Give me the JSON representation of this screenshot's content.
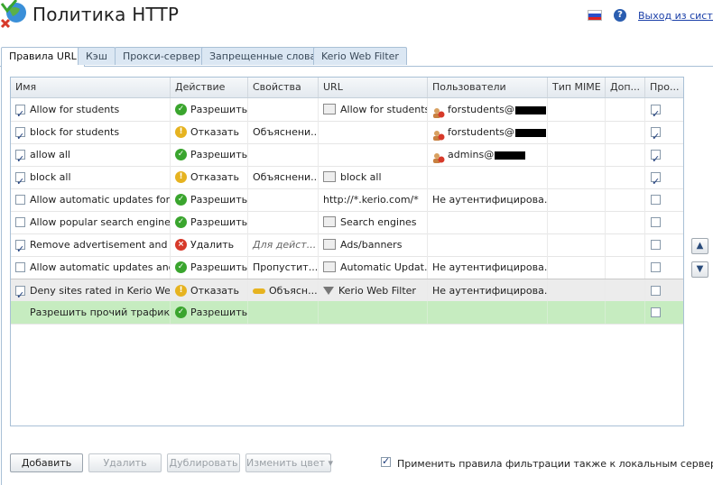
{
  "header": {
    "title": "Политика HTTP",
    "logout": "Выход из систем"
  },
  "tabs": [
    "Правила URL",
    "Кэш",
    "Прокси-сервер",
    "Запрещенные слова",
    "Kerio Web Filter"
  ],
  "columns": [
    "Имя",
    "Действие",
    "Свойства",
    "URL",
    "Пользователи",
    "Тип MIME",
    "Доп...",
    "Про..."
  ],
  "rows": [
    {
      "enabled": true,
      "name": "Allow for students",
      "action": "Разрешить",
      "action_type": "allow",
      "props": "",
      "url": "Allow for students",
      "url_icon": "url-group-icon",
      "users": "forstudents@",
      "mime": "",
      "proto": true
    },
    {
      "enabled": true,
      "name": "block for students",
      "action": "Отказать",
      "action_type": "deny",
      "props": "Объяснени...",
      "url": "",
      "url_icon": "",
      "users": "forstudents@",
      "mime": "",
      "proto": true
    },
    {
      "enabled": true,
      "name": "allow all",
      "action": "Разрешить",
      "action_type": "allow",
      "props": "",
      "url": "",
      "url_icon": "",
      "users": "admins@",
      "mime": "",
      "proto": true
    },
    {
      "enabled": true,
      "name": "block all",
      "action": "Отказать",
      "action_type": "deny",
      "props": "Объяснени...",
      "url": "block all",
      "url_icon": "url-group-icon",
      "users": "",
      "mime": "",
      "proto": true
    },
    {
      "enabled": false,
      "name": "Allow automatic updates for K...",
      "action": "Разрешить",
      "action_type": "allow",
      "props": "",
      "url": "http://*.kerio.com/*",
      "url_icon": "",
      "users": "Не аутентифицирова...",
      "mime": "",
      "proto": false
    },
    {
      "enabled": false,
      "name": "Allow popular search engines",
      "action": "Разрешить",
      "action_type": "allow",
      "props": "",
      "url": "Search engines",
      "url_icon": "url-group-icon",
      "users": "",
      "mime": "",
      "proto": false
    },
    {
      "enabled": true,
      "name": "Remove advertisement and b...",
      "action": "Удалить",
      "action_type": "drop",
      "props": "Для дейст...",
      "url": "Ads/banners",
      "url_icon": "url-group-icon",
      "users": "",
      "mime": "",
      "proto": false
    },
    {
      "enabled": false,
      "name": "Allow automatic updates and ...",
      "action": "Разрешить",
      "action_type": "allow",
      "props": "Пропустит...",
      "url": "Automatic Updat...",
      "url_icon": "url-group-icon",
      "users": "Не аутентифицирова...",
      "mime": "",
      "proto": false
    },
    {
      "enabled": true,
      "name": "Deny sites rated in Kerio Web ...",
      "action": "Отказать",
      "action_type": "deny",
      "props": "Объясн...",
      "url": "Kerio Web Filter",
      "url_icon": "filter-icon",
      "users": "Не аутентифицирова...",
      "mime": "",
      "proto": false
    },
    {
      "enabled": null,
      "name": "Разрешить прочий трафик",
      "action": "Разрешить",
      "action_type": "allow",
      "props": "",
      "url": "",
      "url_icon": "",
      "users": "",
      "mime": "",
      "proto": false
    }
  ],
  "buttons": {
    "add": "Добавить",
    "delete": "Удалить",
    "duplicate": "Дублировать",
    "change_color": "Изменить цвет"
  },
  "apply_local": {
    "checked": true,
    "label": "Применить правила фильтрации также к локальным серверам"
  }
}
